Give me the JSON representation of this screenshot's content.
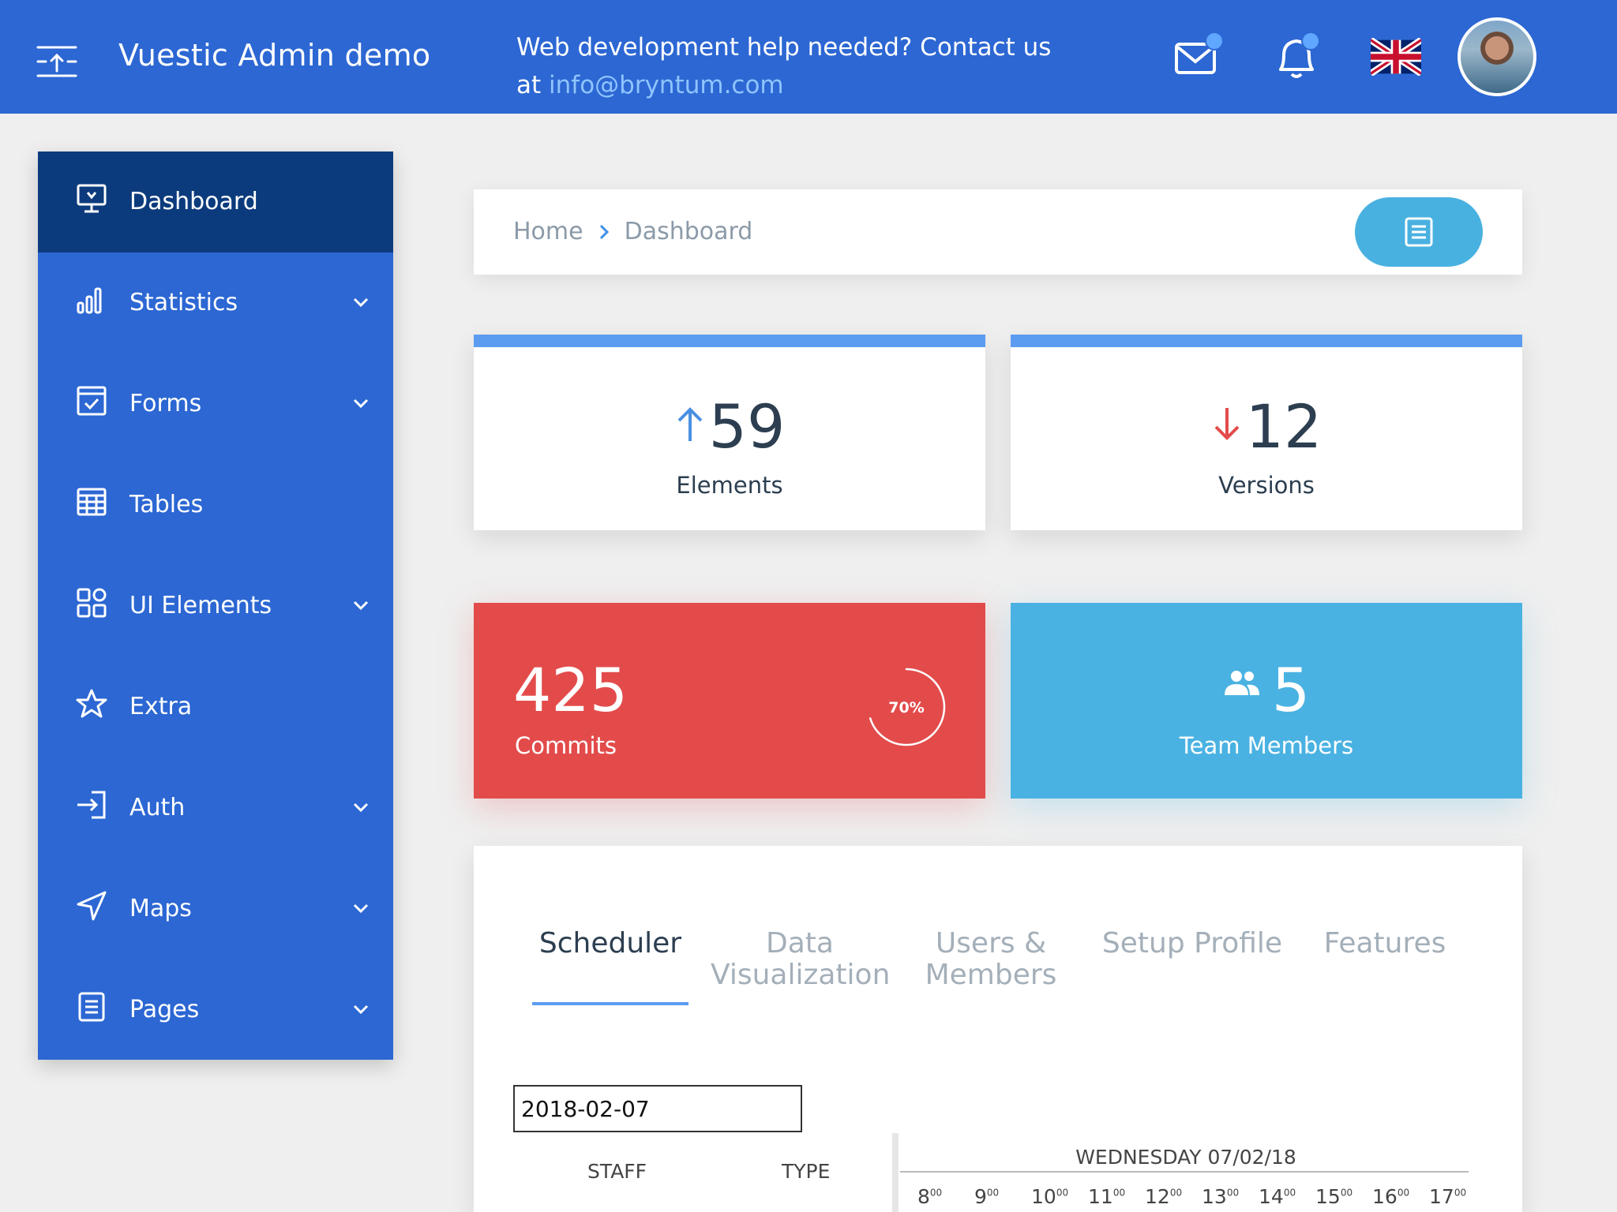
{
  "topbar": {
    "brand": "Vuestic Admin demo",
    "help_text": "Web development help needed? Contact us",
    "help_at": "at",
    "help_email": "info@bryntum.com",
    "bg_color": "#2c67d3"
  },
  "sidebar": {
    "items": [
      {
        "label": "Dashboard",
        "icon": "monitor-icon",
        "active": true,
        "has_children": false
      },
      {
        "label": "Statistics",
        "icon": "bar-chart-icon",
        "has_children": true
      },
      {
        "label": "Forms",
        "icon": "form-check-icon",
        "has_children": true
      },
      {
        "label": "Tables",
        "icon": "table-icon",
        "has_children": false
      },
      {
        "label": "UI Elements",
        "icon": "grid-icon",
        "has_children": true
      },
      {
        "label": "Extra",
        "icon": "star-icon",
        "has_children": false
      },
      {
        "label": "Auth",
        "icon": "login-icon",
        "has_children": true
      },
      {
        "label": "Maps",
        "icon": "navigation-icon",
        "has_children": true
      },
      {
        "label": "Pages",
        "icon": "document-icon",
        "has_children": true
      }
    ]
  },
  "breadcrumb": {
    "home": "Home",
    "current": "Dashboard"
  },
  "stats": {
    "elements": {
      "value": "59",
      "label": "Elements",
      "trend": "up"
    },
    "versions": {
      "value": "12",
      "label": "Versions",
      "trend": "down"
    },
    "commits": {
      "value": "425",
      "label": "Commits",
      "progress_label": "70%",
      "progress": 0.7
    },
    "team": {
      "value": "5",
      "label": "Team Members"
    }
  },
  "tabs": {
    "items": [
      {
        "label": "Scheduler",
        "active": true
      },
      {
        "label": "Data Visualization"
      },
      {
        "label": "Users & Members"
      },
      {
        "label": "Setup Profile"
      },
      {
        "label": "Features"
      }
    ]
  },
  "scheduler": {
    "date_value": "2018-02-07",
    "col_staff": "STAFF",
    "col_type": "TYPE",
    "day_header": "WEDNESDAY 07/02/18",
    "hours": [
      "8",
      "9",
      "10",
      "11",
      "12",
      "13",
      "14",
      "15",
      "16",
      "17"
    ],
    "hour_suffix": "00"
  },
  "colors": {
    "accent_blue": "#5b9cf1",
    "commits_red": "#e34b4b",
    "team_blue": "#4ab2e2",
    "sidebar_active": "#0c3b7d"
  }
}
